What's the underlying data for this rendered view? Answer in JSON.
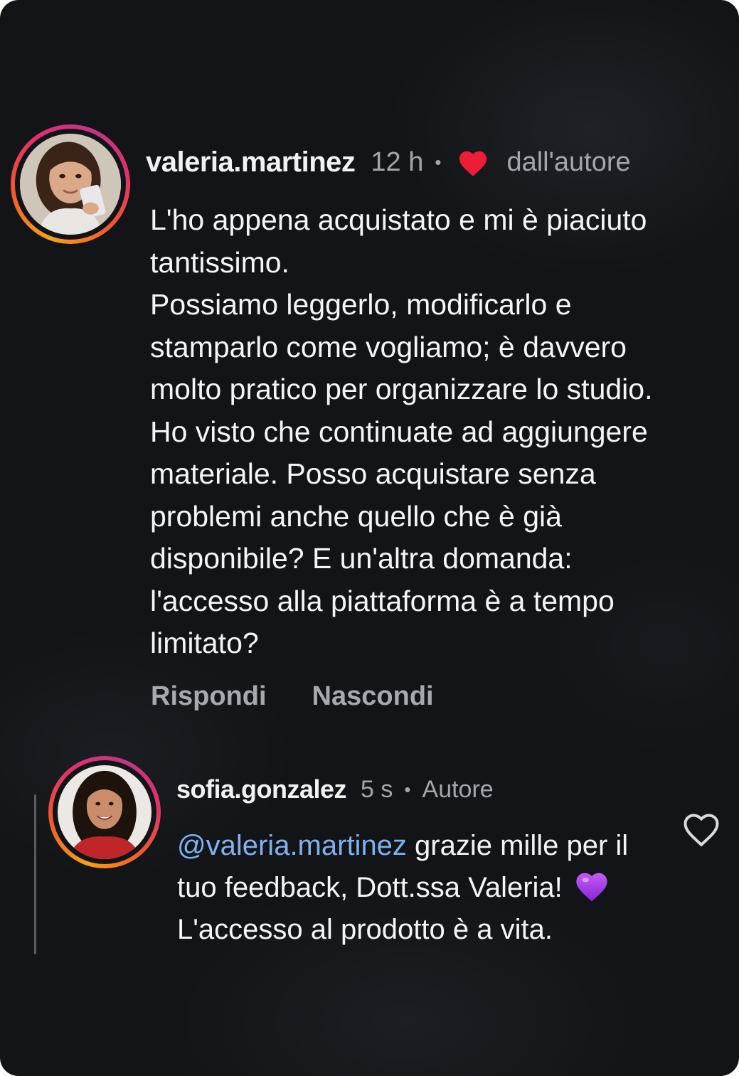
{
  "comment": {
    "username": "valeria.martinez",
    "time": "12 h",
    "separator": "•",
    "liked_by_author_label": "dall'autore",
    "text": "L'ho appena acquistato e mi è piaciuto\ntantissimo.\nPossiamo leggerlo, modificarlo e\nstamparlo come vogliamo; è davvero\nmolto pratico per organizzare lo studio.\nHo visto che continuate ad aggiungere\nmateriale. Posso acquistare senza\nproblemi anche quello che è già\ndisponibile? E un'altra domanda:\nl'accesso alla piattaforma è a tempo\nlimitato?",
    "actions": {
      "reply": "Rispondi",
      "hide": "Nascondi"
    },
    "heart_color": "#ee1d36"
  },
  "reply": {
    "username": "sofia.gonzalez",
    "time": "5 s",
    "separator": "•",
    "role_label": "Autore",
    "mention": "@valeria.martinez",
    "text_part1": " grazie mille per il tuo feedback, Dott.ssa Valeria! ",
    "text_part2": "L'accesso al prodotto è a vita.",
    "emoji_icon": "purple-heart-icon",
    "like_icon": "heart-outline-icon"
  },
  "colors": {
    "background": "#121417",
    "mention": "#7fb2f0",
    "meta_text": "#a3a7ad",
    "purple_heart": "#a335e8"
  }
}
